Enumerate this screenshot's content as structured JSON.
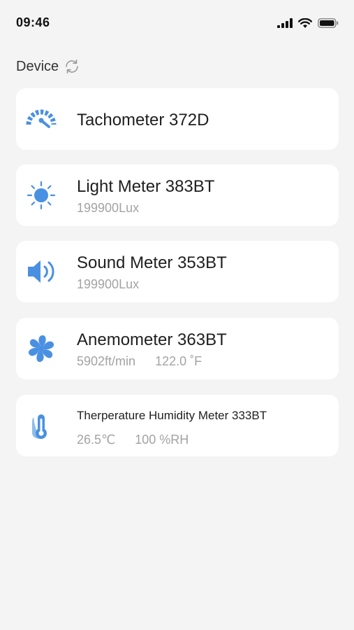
{
  "status_bar": {
    "time": "09:46",
    "icons": [
      "cellular-signal-icon",
      "wifi-icon",
      "battery-icon"
    ]
  },
  "header": {
    "title": "Device",
    "action_icon": "refresh-icon"
  },
  "accent_color": "#4a90e2",
  "devices": [
    {
      "name": "Tachometer 372D",
      "icon": "tachometer-icon"
    },
    {
      "name": "Light Meter 383BT",
      "icon": "sun-icon",
      "reading": "199900Lux"
    },
    {
      "name": "Sound Meter 353BT",
      "icon": "speaker-icon",
      "reading": "199900Lux"
    },
    {
      "name": "Anemometer 363BT",
      "icon": "fan-icon",
      "reading": "5902ft/min",
      "reading2": "122.0 ˚F"
    },
    {
      "name": "Therperature Humidity Meter 333BT",
      "icon": "thermometer-icon",
      "reading": "26.5℃",
      "reading2": "100 %RH"
    }
  ]
}
